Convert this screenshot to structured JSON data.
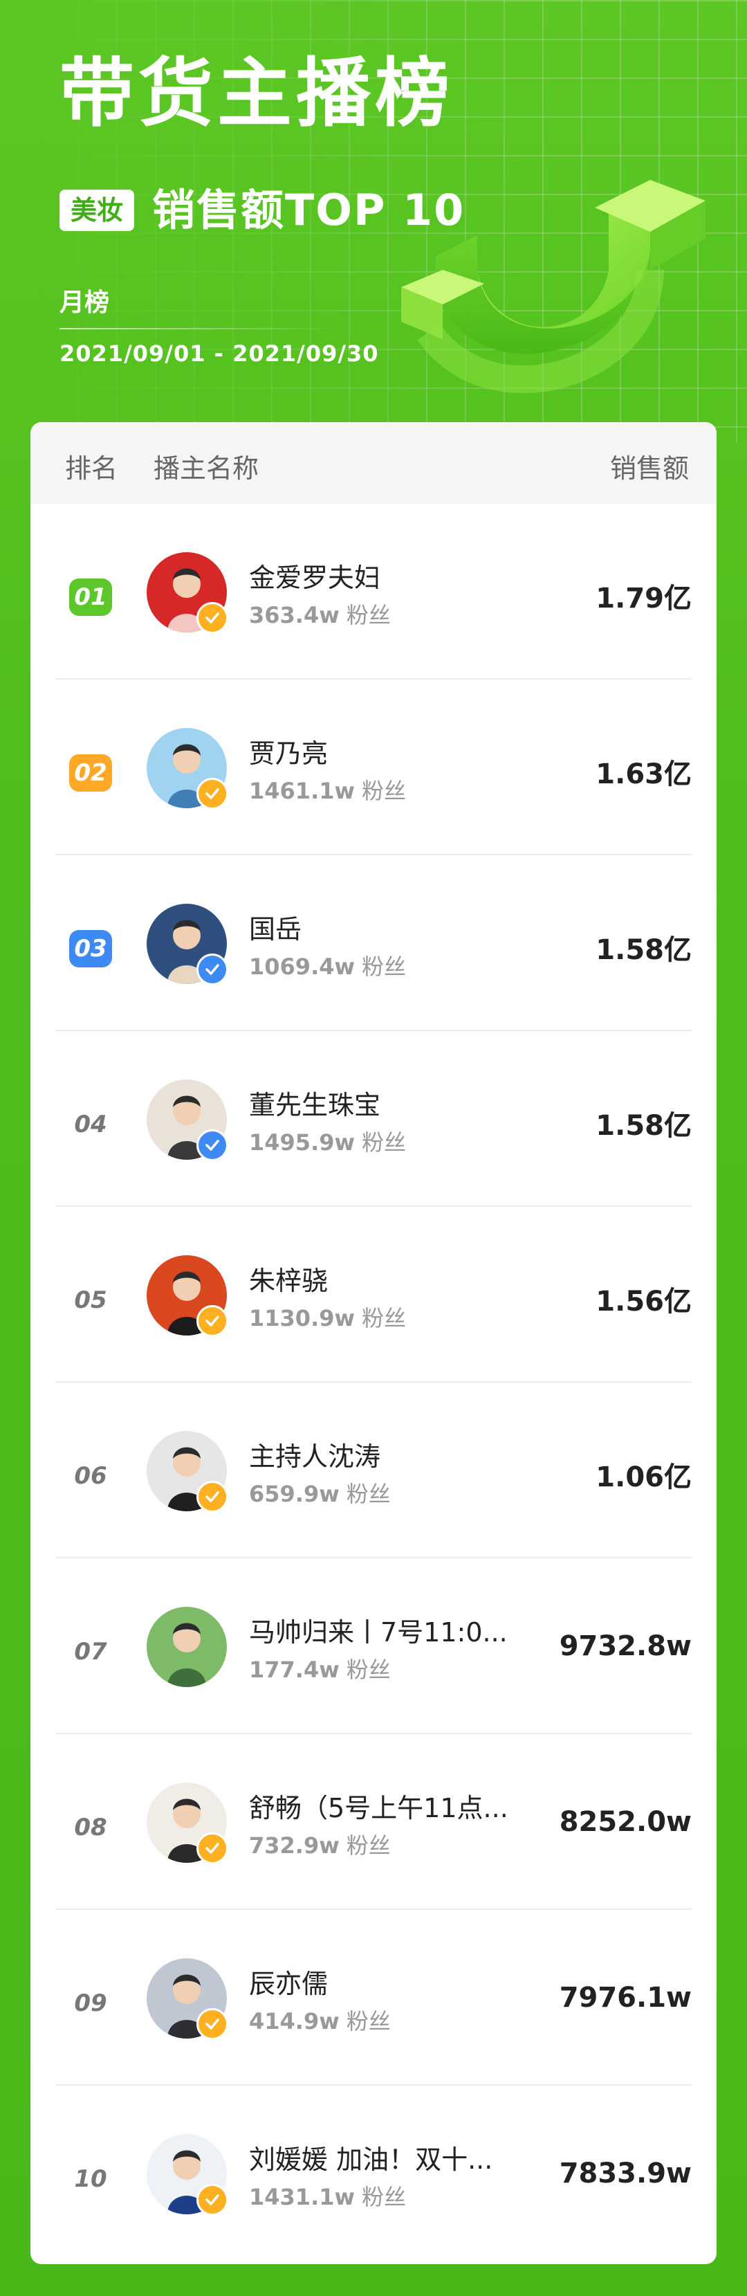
{
  "header": {
    "title": "带货主播榜",
    "category": "美妆",
    "subtitle": "销售额TOP 10",
    "period": "月榜",
    "date_range": "2021/09/01 - 2021/09/30"
  },
  "table": {
    "col_rank": "排名",
    "col_name": "播主名称",
    "col_sales": "销售额",
    "fans_label": "粉丝"
  },
  "colors": {
    "brand_green": "#4fbd1c",
    "rank1": "#5bc72a",
    "rank2": "#ffa726",
    "rank3": "#3d8bf2",
    "verify_gold": "#ffb020",
    "verify_blue": "#3d8bf2"
  },
  "rows": [
    {
      "rank": "01",
      "name": "金爱罗夫妇",
      "fans": "363.4w",
      "sales": "1.79亿",
      "verified": "gold"
    },
    {
      "rank": "02",
      "name": "贾乃亮",
      "fans": "1461.1w",
      "sales": "1.63亿",
      "verified": "gold"
    },
    {
      "rank": "03",
      "name": "国岳",
      "fans": "1069.4w",
      "sales": "1.58亿",
      "verified": "blue"
    },
    {
      "rank": "04",
      "name": "董先生珠宝",
      "fans": "1495.9w",
      "sales": "1.58亿",
      "verified": "blue"
    },
    {
      "rank": "05",
      "name": "朱梓骁",
      "fans": "1130.9w",
      "sales": "1.56亿",
      "verified": "gold"
    },
    {
      "rank": "06",
      "name": "主持人沈涛",
      "fans": "659.9w",
      "sales": "1.06亿",
      "verified": "gold"
    },
    {
      "rank": "07",
      "name": "马帅归来丨7号11:0...",
      "fans": "177.4w",
      "sales": "9732.8w",
      "verified": "none"
    },
    {
      "rank": "08",
      "name": "舒畅（5号上午11点...",
      "fans": "732.9w",
      "sales": "8252.0w",
      "verified": "gold"
    },
    {
      "rank": "09",
      "name": "辰亦儒",
      "fans": "414.9w",
      "sales": "7976.1w",
      "verified": "gold"
    },
    {
      "rank": "10",
      "name": "刘媛媛 加油！双十...",
      "fans": "1431.1w",
      "sales": "7833.9w",
      "verified": "gold"
    }
  ]
}
